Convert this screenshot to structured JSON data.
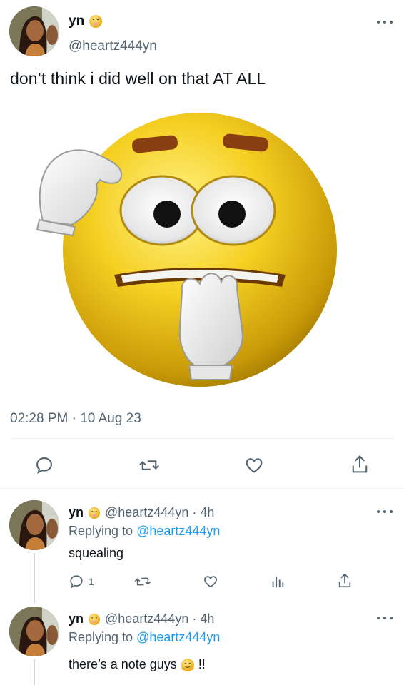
{
  "main_tweet": {
    "display_name": "yn",
    "handle": "@heartz444yn",
    "text": "don’t think i did well on that AT ALL",
    "timestamp": "02:28 PM · 10 Aug 23",
    "name_emoji": "shushing-face-emoji",
    "image_description_icon": "nervous-emoji-image"
  },
  "replies": [
    {
      "display_name": "yn",
      "handle_time": "@heartz444yn · 4h",
      "replying_prefix": "Replying to",
      "replying_to": "@heartz444yn",
      "text": "squealing",
      "reply_count": "1"
    },
    {
      "display_name": "yn",
      "handle_time": "@heartz444yn · 4h",
      "replying_prefix": "Replying to",
      "replying_to": "@heartz444yn",
      "text_before": "there’s a note guys",
      "text_after": "!!"
    }
  ],
  "colors": {
    "accent": "#1d9bf0",
    "muted": "#536471",
    "divider": "#eff3f4",
    "emoji_yellow": "#f2c21d"
  }
}
